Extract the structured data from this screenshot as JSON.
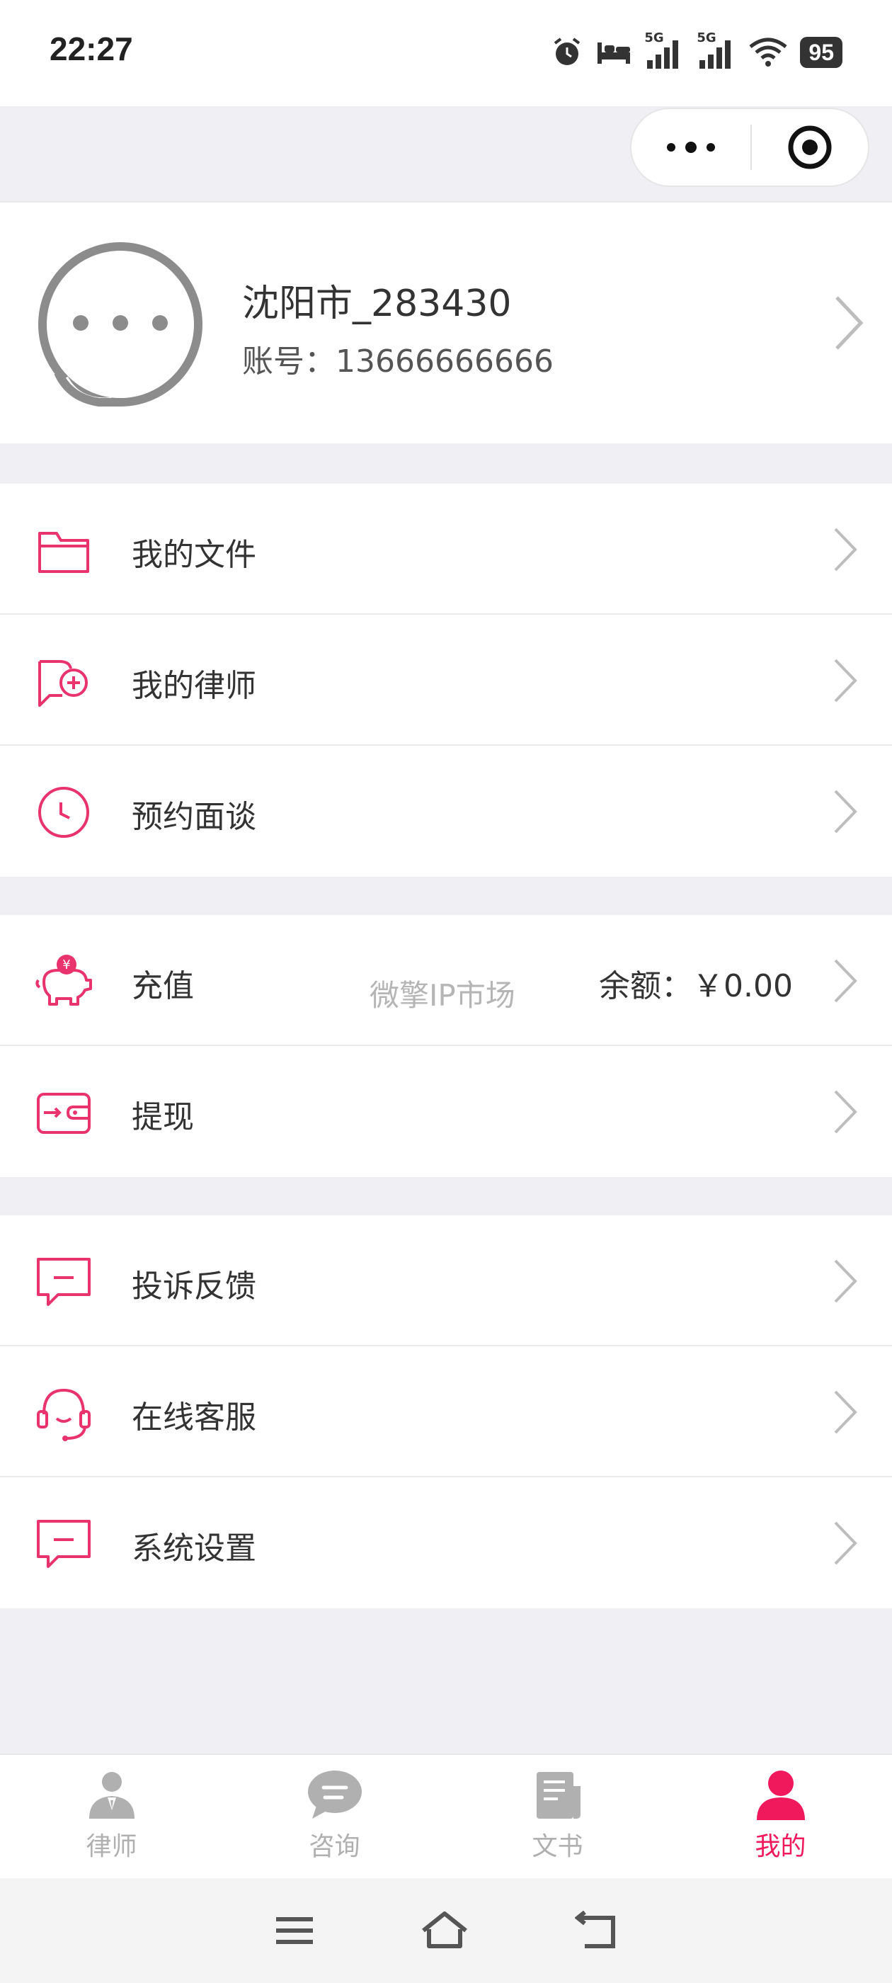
{
  "status_bar": {
    "time": "22:27",
    "signal_1": "5G",
    "signal_2": "5G",
    "battery": "95"
  },
  "profile": {
    "name": "沈阳市_283430",
    "account": "账号：13666666666"
  },
  "menu": {
    "group1": [
      {
        "label": "我的文件",
        "icon": "folder-icon"
      },
      {
        "label": "我的律师",
        "icon": "lawyer-add-icon"
      },
      {
        "label": "预约面谈",
        "icon": "clock-icon"
      }
    ],
    "group2": [
      {
        "label": "充值",
        "icon": "piggy-bank-icon",
        "value": "余额：￥0.00"
      },
      {
        "label": "提现",
        "icon": "wallet-icon"
      }
    ],
    "group3": [
      {
        "label": "投诉反馈",
        "icon": "feedback-icon"
      },
      {
        "label": "在线客服",
        "icon": "headset-icon"
      },
      {
        "label": "系统设置",
        "icon": "settings-message-icon"
      }
    ]
  },
  "watermark": "微擎IP市场",
  "tabs": [
    {
      "label": "律师",
      "icon": "person-suit-icon",
      "active": false
    },
    {
      "label": "咨询",
      "icon": "chat-bubble-icon",
      "active": false
    },
    {
      "label": "文书",
      "icon": "document-icon",
      "active": false
    },
    {
      "label": "我的",
      "icon": "user-icon",
      "active": true
    }
  ],
  "colors": {
    "accent": "#f0195c",
    "icon_pink": "#e8336d",
    "background": "#efeff4",
    "inactive_tab": "#b0b0b0"
  }
}
